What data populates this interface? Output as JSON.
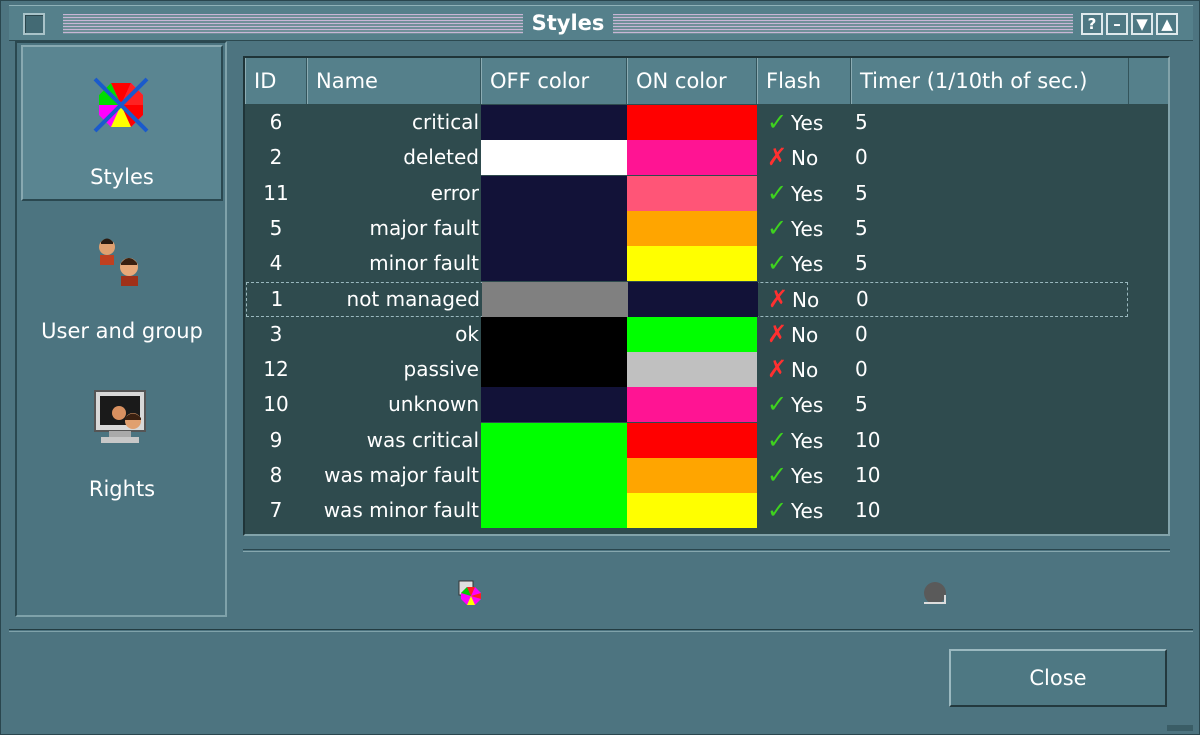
{
  "window": {
    "title": "Styles",
    "title_buttons": {
      "help": "?",
      "minimize": "–",
      "maximize": "▼",
      "shade": "▲"
    }
  },
  "sidebar": {
    "items": [
      {
        "label": "Styles",
        "icon": "styles-icon",
        "active": true
      },
      {
        "label": "User and group",
        "icon": "users-icon",
        "active": false
      },
      {
        "label": "Rights",
        "icon": "rights-icon",
        "active": false
      }
    ]
  },
  "table": {
    "columns": [
      "ID",
      "Name",
      "OFF color",
      "ON color",
      "Flash",
      "Timer (1/10th of sec.)"
    ],
    "rows": [
      {
        "id": "6",
        "name": "critical",
        "off_color": "#121238",
        "on_color": "#ff0000",
        "flash": "Yes",
        "timer": "5"
      },
      {
        "id": "2",
        "name": "deleted",
        "off_color": "#ffffff",
        "on_color": "#ff1493",
        "flash": "No",
        "timer": "0"
      },
      {
        "id": "11",
        "name": "error",
        "off_color": "#121238",
        "on_color": "#ff5577",
        "flash": "Yes",
        "timer": "5"
      },
      {
        "id": "5",
        "name": "major fault",
        "off_color": "#121238",
        "on_color": "#ffa500",
        "flash": "Yes",
        "timer": "5"
      },
      {
        "id": "4",
        "name": "minor fault",
        "off_color": "#121238",
        "on_color": "#ffff00",
        "flash": "Yes",
        "timer": "5"
      },
      {
        "id": "1",
        "name": "not managed",
        "off_color": "#808080",
        "on_color": "#121238",
        "flash": "No",
        "timer": "0",
        "focused": true
      },
      {
        "id": "3",
        "name": "ok",
        "off_color": "#000000",
        "on_color": "#00ff00",
        "flash": "No",
        "timer": "0"
      },
      {
        "id": "12",
        "name": "passive",
        "off_color": "#000000",
        "on_color": "#c0c0c0",
        "flash": "No",
        "timer": "0"
      },
      {
        "id": "10",
        "name": "unknown",
        "off_color": "#121238",
        "on_color": "#ff1493",
        "flash": "Yes",
        "timer": "5"
      },
      {
        "id": "9",
        "name": "was critical",
        "off_color": "#00ff00",
        "on_color": "#ff0000",
        "flash": "Yes",
        "timer": "10"
      },
      {
        "id": "8",
        "name": "was major fault",
        "off_color": "#00ff00",
        "on_color": "#ffa500",
        "flash": "Yes",
        "timer": "10"
      },
      {
        "id": "7",
        "name": "was minor fault",
        "off_color": "#00ff00",
        "on_color": "#ffff00",
        "flash": "Yes",
        "timer": "10"
      }
    ]
  },
  "toolbar": {
    "add_style_icon": "add-style-icon",
    "delete_style_icon": "delete-style-icon"
  },
  "footer": {
    "close_label": "Close"
  },
  "colors": {
    "window_bg": "#4d7480",
    "table_bg": "#2f4b4e",
    "header_bg": "#55808b",
    "yes_mark": "#3ed21f",
    "no_mark": "#ff3030"
  }
}
